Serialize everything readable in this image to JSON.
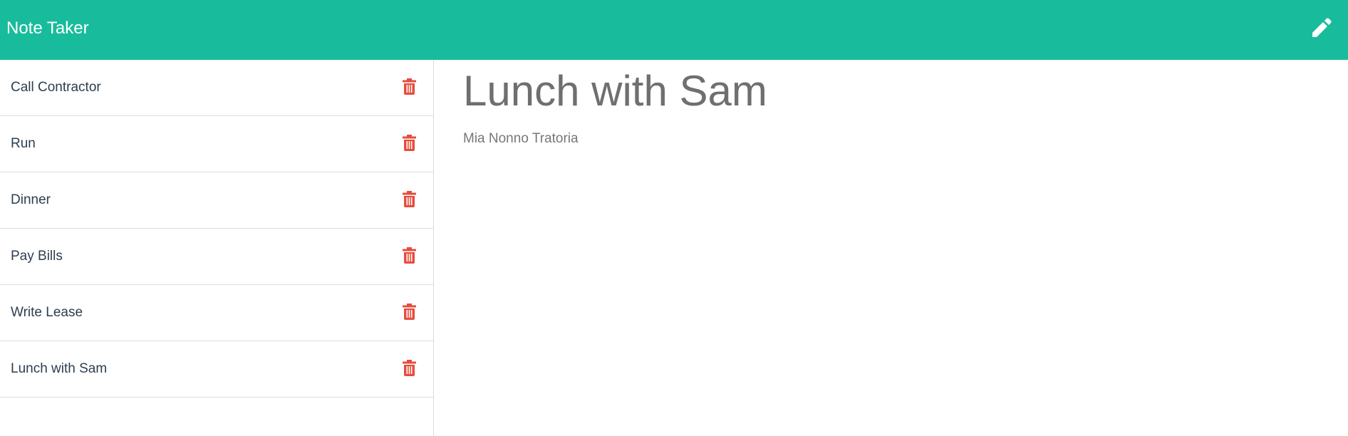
{
  "app": {
    "title": "Note Taker"
  },
  "header": {
    "new_note_icon": "pencil-icon"
  },
  "sidebar": {
    "notes": [
      {
        "title": "Call Contractor",
        "delete_icon": "trash-icon"
      },
      {
        "title": "Run",
        "delete_icon": "trash-icon"
      },
      {
        "title": "Dinner",
        "delete_icon": "trash-icon"
      },
      {
        "title": "Pay Bills",
        "delete_icon": "trash-icon"
      },
      {
        "title": "Write Lease",
        "delete_icon": "trash-icon"
      },
      {
        "title": "Lunch with Sam",
        "delete_icon": "trash-icon"
      }
    ]
  },
  "main": {
    "note_title": "Lunch with Sam",
    "note_text": "Mia Nonno Tratoria"
  },
  "colors": {
    "header_bg": "#18bc9c",
    "delete_icon": "#e74c3c",
    "note_text": "#2c3e50",
    "divider": "#dcdcdc"
  }
}
